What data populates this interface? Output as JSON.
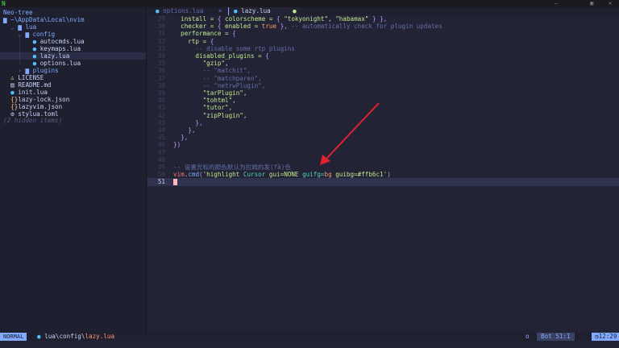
{
  "titlebar": {
    "logo": "N",
    "minimize": "—",
    "maximize": "▣",
    "close": "✕"
  },
  "sidebar": {
    "title": "Neo-tree",
    "root": "~\\AppData\\Local\\nvim",
    "items": [
      {
        "indent": "  ",
        "arrow": "⌄ ",
        "icon": "▆ ",
        "label": "lua",
        "type": "dir"
      },
      {
        "indent": "    ",
        "arrow": "⌄ ",
        "icon": "▆ ",
        "label": "config",
        "type": "dir"
      },
      {
        "indent": "    │   ",
        "arrow": "",
        "icon": "● ",
        "label": "autocmds.lua",
        "type": "lua"
      },
      {
        "indent": "    │   ",
        "arrow": "",
        "icon": "● ",
        "label": "keymaps.lua",
        "type": "lua"
      },
      {
        "indent": "    │   ",
        "arrow": "",
        "icon": "● ",
        "label": "lazy.lua",
        "type": "lua",
        "selected": true
      },
      {
        "indent": "    └   ",
        "arrow": "",
        "icon": "● ",
        "label": "options.lua",
        "type": "lua"
      },
      {
        "indent": "    ",
        "arrow": "› ",
        "icon": "▆ ",
        "label": "plugins",
        "type": "dir"
      },
      {
        "indent": "  ",
        "arrow": "",
        "icon": "♙ ",
        "label": "LICENSE",
        "type": "license"
      },
      {
        "indent": "  ",
        "arrow": "",
        "icon": "▤ ",
        "label": "README.md",
        "type": "md"
      },
      {
        "indent": "  ",
        "arrow": "",
        "icon": "● ",
        "label": "init.lua",
        "type": "lua"
      },
      {
        "indent": "  ",
        "arrow": "",
        "icon": "{}",
        "label": "lazy-lock.json",
        "type": "json"
      },
      {
        "indent": "  ",
        "arrow": "",
        "icon": "{}",
        "label": "lazyvim.json",
        "type": "json"
      },
      {
        "indent": "  ",
        "arrow": "",
        "icon": "⚙ ",
        "label": "stylua.toml",
        "type": "toml"
      }
    ],
    "hidden": "(2 hidden items)"
  },
  "tabs": [
    {
      "label": "options.lua",
      "close": "×",
      "active": false
    },
    {
      "label": "lazy.lua",
      "modified": "●",
      "active": true
    }
  ],
  "editor": {
    "lines": [
      {
        "n": "29",
        "segs": [
          [
            "  install = ",
            "k"
          ],
          [
            "{ ",
            "p"
          ],
          [
            "colorscheme = ",
            "k"
          ],
          [
            "{ ",
            "p"
          ],
          [
            "\"tokyonight\"",
            "s"
          ],
          [
            ", ",
            "cm"
          ],
          [
            "\"habamax\"",
            "s"
          ],
          [
            " } },",
            "p"
          ]
        ]
      },
      {
        "n": "30",
        "segs": [
          [
            "  checker = ",
            "k"
          ],
          [
            "{ ",
            "p"
          ],
          [
            "enabled = ",
            "k"
          ],
          [
            "true",
            "b"
          ],
          [
            " },",
            "p"
          ],
          [
            " -- automatically check for plugin updates",
            "c"
          ]
        ]
      },
      {
        "n": "31",
        "segs": [
          [
            "  performance = ",
            "k"
          ],
          [
            "{",
            "p"
          ]
        ]
      },
      {
        "n": "32",
        "segs": [
          [
            "    rtp = ",
            "k"
          ],
          [
            "{",
            "p"
          ]
        ]
      },
      {
        "n": "33",
        "segs": [
          [
            "      -- disable some rtp plugins",
            "c"
          ]
        ]
      },
      {
        "n": "34",
        "segs": [
          [
            "      disabled_plugins = ",
            "k"
          ],
          [
            "{",
            "p"
          ]
        ]
      },
      {
        "n": "35",
        "segs": [
          [
            "        \"gzip\"",
            "s"
          ],
          [
            ",",
            "cm"
          ]
        ]
      },
      {
        "n": "36",
        "segs": [
          [
            "        -- \"matchit\",",
            "c"
          ]
        ]
      },
      {
        "n": "37",
        "segs": [
          [
            "        -- \"matchparen\",",
            "c"
          ]
        ]
      },
      {
        "n": "38",
        "segs": [
          [
            "        -- \"netrwPlugin\",",
            "c"
          ]
        ]
      },
      {
        "n": "39",
        "segs": [
          [
            "        \"tarPlugin\"",
            "s"
          ],
          [
            ",",
            "cm"
          ]
        ]
      },
      {
        "n": "40",
        "segs": [
          [
            "        \"tohtml\"",
            "s"
          ],
          [
            ",",
            "cm"
          ]
        ]
      },
      {
        "n": "41",
        "segs": [
          [
            "        \"tutor\"",
            "s"
          ],
          [
            ",",
            "cm"
          ]
        ]
      },
      {
        "n": "42",
        "segs": [
          [
            "        \"zipPlugin\"",
            "s"
          ],
          [
            ",",
            "cm"
          ]
        ]
      },
      {
        "n": "43",
        "segs": [
          [
            "      },",
            "p"
          ]
        ]
      },
      {
        "n": "44",
        "segs": [
          [
            "    },",
            "p"
          ]
        ]
      },
      {
        "n": "45",
        "segs": [
          [
            "  },",
            "p"
          ]
        ]
      },
      {
        "n": "46",
        "segs": [
          [
            "})",
            "p"
          ]
        ]
      },
      {
        "n": "47",
        "segs": []
      },
      {
        "n": "48",
        "segs": []
      },
      {
        "n": "49",
        "segs": [
          [
            "-- 设置光标的颜色默认为拉姆的发(fà)色",
            "c"
          ]
        ]
      },
      {
        "n": "50",
        "segs": [
          [
            "vim",
            "f"
          ],
          [
            ".",
            "cm"
          ],
          [
            "cmd",
            "m"
          ],
          [
            "(",
            "p"
          ],
          [
            "'highlight ",
            "s"
          ],
          [
            "Cursor ",
            "t"
          ],
          [
            "gui=NONE ",
            "s"
          ],
          [
            "guifg=",
            "t"
          ],
          [
            "bg ",
            "b"
          ],
          [
            "guibg=#ffb6c1'",
            "s"
          ],
          [
            ")",
            "p"
          ]
        ]
      },
      {
        "n": "51",
        "segs": [],
        "cursor": true
      }
    ]
  },
  "status": {
    "mode": "NORMAL",
    "dir": "lua\\config\\",
    "file": "lazy.lua",
    "indicator": "o",
    "position": "Bot",
    "cursor": "51:1",
    "time": "12:29"
  },
  "colors": {
    "accent": "#82aaff",
    "cursor": "#ffb6c1",
    "arrow": "#e3222e"
  }
}
